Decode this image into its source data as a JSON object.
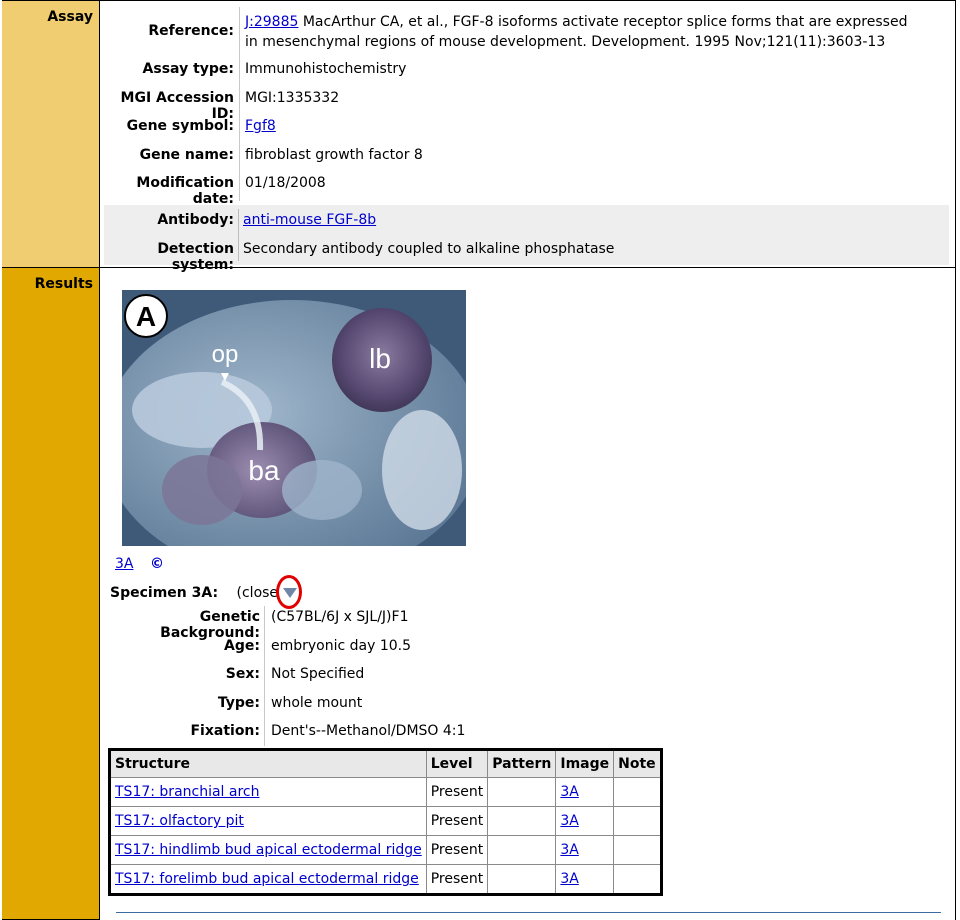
{
  "sections": {
    "assay": "Assay",
    "results": "Results"
  },
  "assay": {
    "reference_label": "Reference:",
    "reference_link": "J:29885",
    "reference_line1": " MacArthur CA, et al., FGF-8 isoforms activate receptor splice forms that are expressed",
    "reference_line2": "in mesenchymal regions of mouse development. Development. 1995 Nov;121(11):3603-13",
    "assay_type_label": "Assay type:",
    "assay_type": "Immunohistochemistry",
    "accession_label": "MGI Accession ID:",
    "accession": "MGI:1335332",
    "gene_symbol_label": "Gene symbol:",
    "gene_symbol": "Fgf8",
    "gene_name_label": "Gene name:",
    "gene_name": "fibroblast growth factor 8",
    "mod_date_label": "Modification date:",
    "mod_date": "01/18/2008",
    "antibody_label": "Antibody:",
    "antibody": "anti-mouse FGF-8b",
    "detection_label": "Detection system:",
    "detection": "Secondary antibody coupled to alkaline phosphatase"
  },
  "image": {
    "panel_letter": "A",
    "labels": {
      "op": "op",
      "lb": "lb",
      "ba": "ba"
    },
    "link_label": "3A",
    "copyright": "©"
  },
  "specimen": {
    "title": "Specimen 3A:",
    "toggle": "(close",
    "genetic_background_label": "Genetic Background:",
    "genetic_background": "(C57BL/6J x SJL/J)F1",
    "age_label": "Age:",
    "age": "embryonic day 10.5",
    "sex_label": "Sex:",
    "sex": "Not Specified",
    "type_label": "Type:",
    "type": "whole mount",
    "fixation_label": "Fixation:",
    "fixation": "Dent's--Methanol/DMSO 4:1"
  },
  "table": {
    "headers": [
      "Structure",
      "Level",
      "Pattern",
      "Image",
      "Note"
    ],
    "rows": [
      {
        "structure": "TS17: branchial arch",
        "level": "Present",
        "pattern": "",
        "image": "3A",
        "note": ""
      },
      {
        "structure": "TS17: olfactory pit",
        "level": "Present",
        "pattern": "",
        "image": "3A",
        "note": ""
      },
      {
        "structure": "TS17: hindlimb bud apical ectodermal ridge",
        "level": "Present",
        "pattern": "",
        "image": "3A",
        "note": ""
      },
      {
        "structure": "TS17: forelimb bud apical ectodermal ridge",
        "level": "Present",
        "pattern": "",
        "image": "3A",
        "note": ""
      }
    ]
  },
  "colors": {
    "assay_header": "#f0cd70",
    "results_header": "#e0a800",
    "link": "#0000cc",
    "annotation_circle": "#e00000"
  }
}
